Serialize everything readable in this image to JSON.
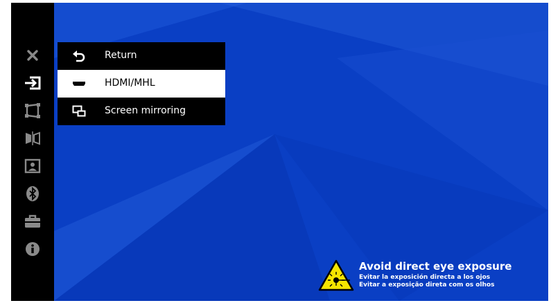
{
  "sidebar": {
    "items": [
      {
        "name": "close-icon"
      },
      {
        "name": "input-icon"
      },
      {
        "name": "keystone-icon"
      },
      {
        "name": "flip-icon"
      },
      {
        "name": "picture-icon"
      },
      {
        "name": "bluetooth-icon"
      },
      {
        "name": "toolbox-icon"
      },
      {
        "name": "info-icon"
      }
    ],
    "selected_index": 1
  },
  "menu": {
    "items": [
      {
        "label": "Return",
        "icon": "return-icon"
      },
      {
        "label": "HDMI/MHL",
        "icon": "hdmi-icon",
        "selected": true
      },
      {
        "label": "Screen mirroring",
        "icon": "screen-mirroring-icon"
      }
    ]
  },
  "warning": {
    "title": "Avoid direct eye exposure",
    "line_es": "Evitar la exposición directa a los ojos",
    "line_pt": "Evitar a exposição direta com os olhos",
    "icon": "laser-warning-icon"
  },
  "colors": {
    "background": "#0a3fc4",
    "panel": "#000000",
    "selected_row": "#ffffff",
    "warning_yellow": "#f5e400",
    "sidebar_active": "#ffffff",
    "sidebar_inactive": "#8a8a8a"
  }
}
